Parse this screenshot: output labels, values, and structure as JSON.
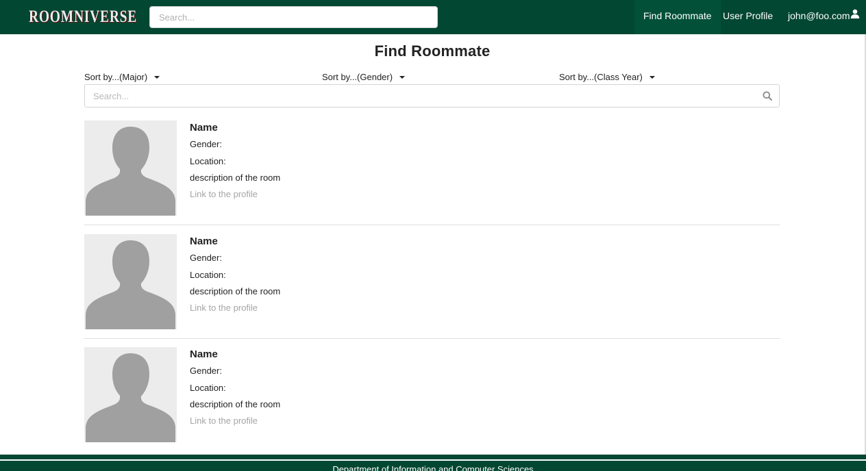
{
  "navbar": {
    "brand": "ROOMNIVERSE",
    "search_placeholder": "Search...",
    "links": {
      "find_roommate": "Find Roommate",
      "user_profile": "User Profile",
      "user_email": "john@foo.com"
    }
  },
  "page": {
    "title": "Find Roommate"
  },
  "filters": {
    "major": "Sort by...(Major)",
    "gender": "Sort by...(Gender)",
    "class_year": "Sort by...(Class Year)"
  },
  "search": {
    "placeholder": "Search..."
  },
  "profiles": [
    {
      "name": "Name",
      "gender": "Gender:",
      "location": "Location:",
      "description": "description of the room",
      "link": "Link to the profile"
    },
    {
      "name": "Name",
      "gender": "Gender:",
      "location": "Location:",
      "description": "description of the room",
      "link": "Link to the profile"
    },
    {
      "name": "Name",
      "gender": "Gender:",
      "location": "Location:",
      "description": "description of the room",
      "link": "Link to the profile"
    }
  ],
  "footer": {
    "text": "Department of Information and Computer Sciences"
  },
  "colors": {
    "brand_green": "#024731",
    "avatar_silhouette": "#a0a0a0",
    "avatar_bg": "#ececec",
    "muted_link": "#a5a5a5"
  },
  "icons": {
    "user": "user-icon",
    "search": "search-icon",
    "caret": "caret-down-icon",
    "avatar": "avatar-placeholder-icon"
  }
}
